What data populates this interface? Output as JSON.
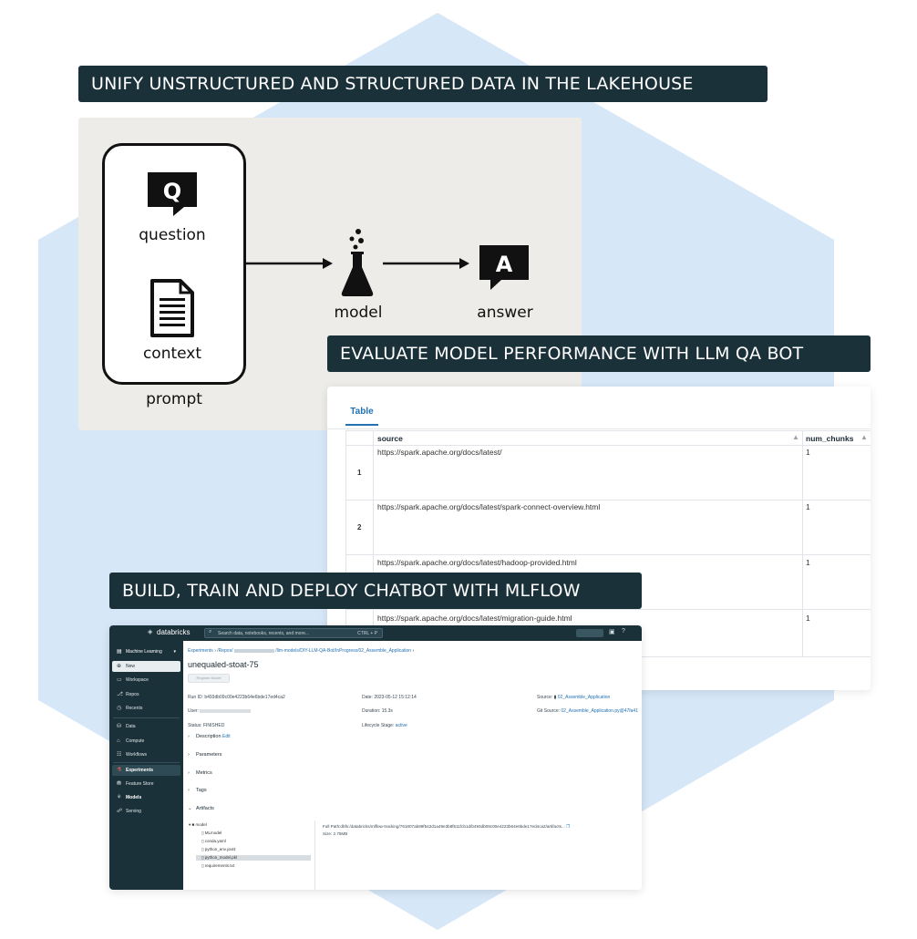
{
  "banners": {
    "unify": "UNIFY UNSTRUCTURED AND STRUCTURED DATA IN THE LAKEHOUSE",
    "evaluate": "EVALUATE MODEL PERFORMANCE WITH LLM QA BOT",
    "build": "BUILD, TRAIN AND DEPLOY CHATBOT WITH MLFLOW"
  },
  "diagram": {
    "question_glyph": "Q",
    "question_label": "question",
    "context_label": "context",
    "prompt_label": "prompt",
    "model_label": "model",
    "answer_glyph": "A",
    "answer_label": "answer",
    "icons": [
      "question-bubble-icon",
      "document-icon",
      "flask-icon",
      "answer-bubble-icon",
      "arrow-right-icon"
    ]
  },
  "table": {
    "tab_label": "Table",
    "columns": [
      "source",
      "num_chunks"
    ],
    "rows": [
      {
        "index": "1",
        "source": "https://spark.apache.org/docs/latest/",
        "num_chunks": "1"
      },
      {
        "index": "2",
        "source": "https://spark.apache.org/docs/latest/spark-connect-overview.html",
        "num_chunks": "1"
      },
      {
        "index": "",
        "source": "https://spark.apache.org/docs/latest/hadoop-provided.html",
        "num_chunks": "1"
      },
      {
        "index": "",
        "source": "https://spark.apache.org/docs/latest/migration-guide.html",
        "num_chunks": "1"
      }
    ]
  },
  "mlflow": {
    "brand": "databricks",
    "search_placeholder": "Search data, notebooks, recents, and more...",
    "search_shortcut": "CTRL + P",
    "sidebar": {
      "selector": "Machine Learning",
      "new_label": "New",
      "items": [
        {
          "label": "Workspace",
          "icon": "folder-icon"
        },
        {
          "label": "Repos",
          "icon": "repo-icon"
        },
        {
          "label": "Recents",
          "icon": "clock-icon"
        },
        {
          "label": "Data",
          "icon": "data-icon"
        },
        {
          "label": "Compute",
          "icon": "compute-icon"
        },
        {
          "label": "Workflows",
          "icon": "workflow-icon"
        }
      ],
      "ml_items": [
        {
          "label": "Experiments",
          "icon": "flask-icon"
        },
        {
          "label": "Feature Store",
          "icon": "store-icon"
        },
        {
          "label": "Models",
          "icon": "model-icon"
        },
        {
          "label": "Serving",
          "icon": "serving-icon"
        }
      ]
    },
    "breadcrumb": {
      "experiments": "Experiments",
      "repos": "/Repos/",
      "path": "/llm-models/DIY-LLM-QA-Bot/InProgress/02_Assemble_Application"
    },
    "run_name": "unequaled-stoat-75",
    "register_label": "Register Model",
    "details": {
      "run_id_label": "Run ID:",
      "run_id": "b493db09c00e4223b64e6bde17ed4ca2",
      "user_label": "User:",
      "status_label": "Status:",
      "status": "FINISHED",
      "date_label": "Date:",
      "date": "2023-05-12 15:12:14",
      "duration_label": "Duration:",
      "duration": "15.3s",
      "lifecycle_label": "Lifecycle Stage:",
      "lifecycle": "active",
      "source_label": "Source:",
      "source": "02_Assemble_Application",
      "git_source_label": "Git Source:",
      "git_source": "02_Assemble_Application.py@47fa41"
    },
    "sections": {
      "description": "Description",
      "edit": "Edit",
      "parameters": "Parameters",
      "metrics": "Metrics",
      "tags": "Tags",
      "artifacts": "Artifacts"
    },
    "artifacts": {
      "folder": "model",
      "files": [
        "MLmodel",
        "conda.yaml",
        "python_env.yaml",
        "python_model.pkl",
        "requirements.txt"
      ],
      "selected": "python_model.pkl",
      "full_path": "Full Path:dbfs:/databricks/mlflow-tracking/761807ab89f542d1a49e3b8f511fcb1d/b493db09c00e4223b64e6bde17ed4ca2/artifacts...",
      "size": "Size: 2.75MB"
    }
  }
}
